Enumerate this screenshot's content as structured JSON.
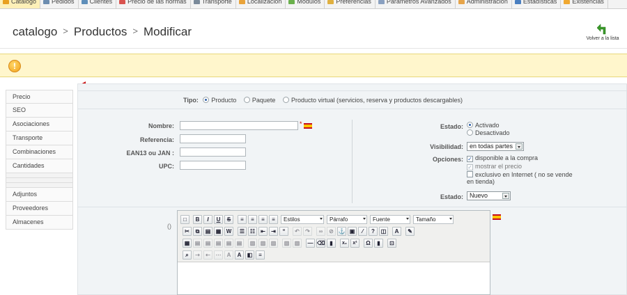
{
  "top_menu": {
    "tabs": [
      {
        "label": "Catálogo",
        "icon": "catalog-icon",
        "color": "#e8a020"
      },
      {
        "label": "Pedidos",
        "icon": "cart-icon",
        "color": "#6c8db0"
      },
      {
        "label": "Clientes",
        "icon": "customers-icon",
        "color": "#5f8fba"
      },
      {
        "label": "Precio de las normas",
        "icon": "price-rules-icon",
        "color": "#d9534f"
      },
      {
        "label": "Transporte",
        "icon": "truck-icon",
        "color": "#7a8a9a"
      },
      {
        "label": "Localización",
        "icon": "globe-icon",
        "color": "#e9a33a"
      },
      {
        "label": "Módulos",
        "icon": "modules-icon",
        "color": "#6ab04c"
      },
      {
        "label": "Preferencias",
        "icon": "preferences-icon",
        "color": "#e0b040"
      },
      {
        "label": "Parámetros Avanzados",
        "icon": "advanced-icon",
        "color": "#8aa0c0"
      },
      {
        "label": "Administración",
        "icon": "admin-icon",
        "color": "#e6a44a"
      },
      {
        "label": "Estadísticas",
        "icon": "stats-icon",
        "color": "#4a7fc0"
      },
      {
        "label": "Existencias",
        "icon": "stock-icon",
        "color": "#f0a830"
      }
    ]
  },
  "header": {
    "crumb_1": "catalogo",
    "crumb_2": "Productos",
    "crumb_3": "Modificar",
    "back_label": "Volver a la lista"
  },
  "warning": {
    "icon": "warning-icon",
    "symbol": "!"
  },
  "sidebar": {
    "items": [
      "Precio",
      "SEO",
      "Asociaciones",
      "Transporte",
      "Combinaciones",
      "Cantidades",
      "",
      "",
      "",
      "Adjuntos",
      "Proveedores",
      "Almacenes"
    ]
  },
  "form": {
    "tipo_label": "Tipo:",
    "tipo_options": [
      "Producto",
      "Paquete",
      "Producto virtual (servicios, reserva y productos descargables)"
    ],
    "nombre_label": "Nombre:",
    "referencia_label": "Referencia:",
    "ean_label": "EAN13 ou JAN :",
    "upc_label": "UPC:",
    "required_mark": "*",
    "estado_label": "Estado:",
    "estado_options": [
      "Activado",
      "Desactivado"
    ],
    "visibilidad_label": "Visibilidad:",
    "visibilidad_value": "en todas partes",
    "opciones_label": "Opciones:",
    "opciones": [
      "disponible a la compra",
      "mostrar el precio",
      "exclusivo en Internet ( no se vende en tienda)"
    ],
    "estado2_label": "Estado:",
    "estado2_value": "Nuevo",
    "desc_label": "()"
  },
  "editor": {
    "estilos": "Estilos",
    "parrafo": "Párrafo",
    "fuente": "Fuente",
    "tamano": "Tamaño"
  },
  "colors": {
    "warning_bg": "#fff6cc",
    "panel_bg": "#f1f4f6",
    "arrow": "#cc1515",
    "accent_green": "#3a9a2a"
  }
}
